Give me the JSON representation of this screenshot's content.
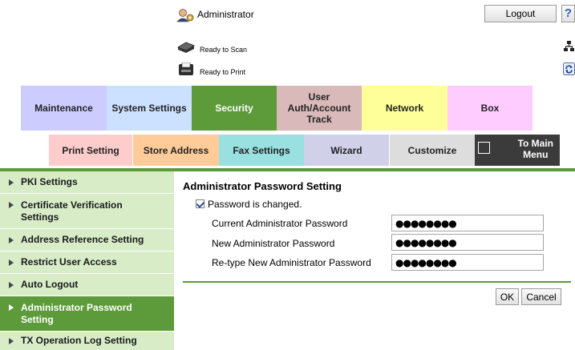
{
  "header": {
    "user_label": "Administrator",
    "logout_label": "Logout",
    "help_glyph": "?",
    "scan_status": "Ready to Scan",
    "print_status": "Ready to Print"
  },
  "main_tabs": [
    {
      "label": "Maintenance",
      "color": "#ccccff"
    },
    {
      "label": "System Settings",
      "color": "#cce0ff"
    },
    {
      "label": "Security",
      "color": "#5d9a3a",
      "active": true
    },
    {
      "label": "User\nAuth/Account\nTrack",
      "color": "#d9b9b9"
    },
    {
      "label": "Network",
      "color": "#ffff99"
    },
    {
      "label": "Box",
      "color": "#ffccff"
    }
  ],
  "sub_tabs": [
    {
      "label": "Print Setting",
      "color": "#ffcccc"
    },
    {
      "label": "Store Address",
      "color": "#ffcc99"
    },
    {
      "label": "Fax Settings",
      "color": "#99e0e0"
    },
    {
      "label": "Wizard",
      "color": "#d0d0e8"
    },
    {
      "label": "Customize",
      "color": "#dddddd"
    }
  ],
  "to_main_menu": "To Main\nMenu",
  "sidebar": {
    "items": [
      {
        "label": "PKI Settings"
      },
      {
        "label": "Certificate Verification\nSettings"
      },
      {
        "label": "Address Reference Setting"
      },
      {
        "label": "Restrict User Access"
      },
      {
        "label": "Auto Logout"
      },
      {
        "label": "Administrator Password\nSetting",
        "active": true
      },
      {
        "label": "TX Operation Log Setting"
      }
    ]
  },
  "content": {
    "title": "Administrator Password Setting",
    "checkbox_label": "Password is changed.",
    "checkbox_checked": true,
    "fields": [
      {
        "label": "Current Administrator Password",
        "value": "●●●●●●●●"
      },
      {
        "label": "New Administrator Password",
        "value": "●●●●●●●●"
      },
      {
        "label": "Re-type New Administrator Password",
        "value": "●●●●●●●●"
      }
    ],
    "ok_label": "OK",
    "cancel_label": "Cancel"
  },
  "colors": {
    "accent_green": "#5d9a3a",
    "sidebar_bg": "#d8ecc8"
  }
}
